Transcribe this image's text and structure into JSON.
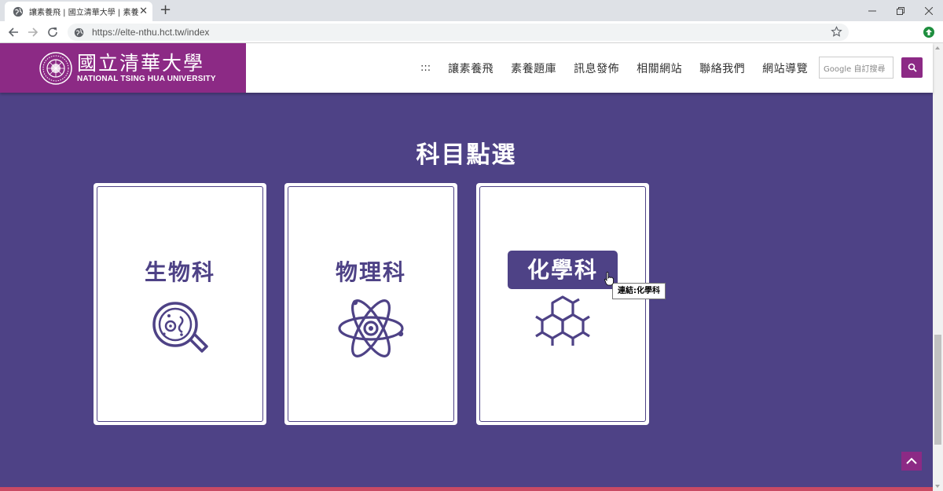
{
  "browser": {
    "tab_title": "讓素養飛 | 國立清華大學 | 素養題",
    "url": "https://elte-nthu.hct.tw/index",
    "icons": {
      "tab_favicon": "globe-icon",
      "close": "close-icon",
      "new_tab": "plus-icon",
      "back": "arrow-left-icon",
      "forward": "arrow-right-icon",
      "reload": "reload-icon",
      "site_info": "globe-icon",
      "bookmark": "star-icon",
      "extension": "extension-icon"
    },
    "window_controls": [
      "minimize",
      "maximize",
      "close"
    ]
  },
  "header": {
    "logo_zh": "國立清華大學",
    "logo_en": "NATIONAL TSING HUA UNIVERSITY",
    "nav_dots": ":::",
    "nav": [
      "讓素養飛",
      "素養題庫",
      "訊息發佈",
      "相關網站",
      "聯絡我們",
      "網站導覽"
    ],
    "search_placeholder": "Google 自訂搜尋",
    "search_icon": "search-icon",
    "brand_color": "#8c2a85"
  },
  "main": {
    "title": "科目點選",
    "background_color": "#4e4286",
    "subjects": [
      {
        "label": "生物科",
        "icon": "microscope-cell-icon"
      },
      {
        "label": "物理科",
        "icon": "atom-icon"
      },
      {
        "label": "化學科",
        "icon": "molecule-hexagon-icon",
        "hovered": true
      }
    ],
    "tooltip": "連結:化學科",
    "scroll_top_icon": "chevron-up-icon",
    "footer_color": "#c94a63"
  }
}
